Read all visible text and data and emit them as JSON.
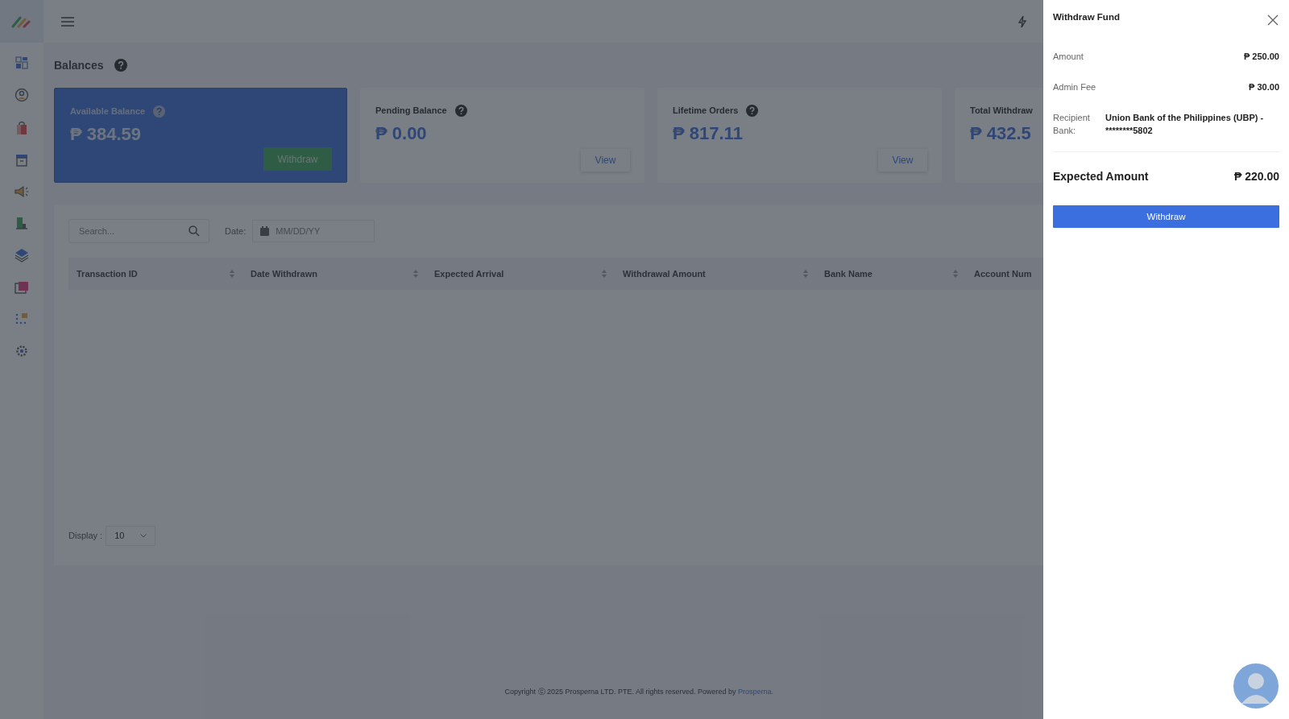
{
  "page_title": "Balances",
  "cards": [
    {
      "kind": "primary",
      "label": "Available Balance",
      "amount": "₱ 384.59",
      "button": "Withdraw"
    },
    {
      "kind": "plain",
      "label": "Pending Balance",
      "amount": "₱ 0.00",
      "button": "View"
    },
    {
      "kind": "plain",
      "label": "Lifetime Orders",
      "amount": "₱ 817.11",
      "button": "View"
    },
    {
      "kind": "plain",
      "label": "Total Withdraw",
      "amount": "₱ 432.5"
    }
  ],
  "filters": {
    "search": {
      "placeholder": "Search..."
    },
    "date_label": "Date:",
    "date": {
      "placeholder": "MM/DD/YY"
    }
  },
  "table": {
    "columns": [
      "Transaction ID",
      "Date Withdrawn",
      "Expected Arrival",
      "Withdrawal Amount",
      "Bank Name",
      "Account Num"
    ]
  },
  "pagination": {
    "label": "Display :",
    "value": "10"
  },
  "footer": {
    "text": "Copyright ⓒ 2025 Prosperna LTD. PTE. All rights reserved. Powered by",
    "link": "Prosperna."
  },
  "drawer": {
    "title": "Withdraw Fund",
    "rows": [
      {
        "label": "Amount",
        "value": "₱ 250.00"
      },
      {
        "label": "Admin Fee",
        "value": "₱ 30.00"
      },
      {
        "label": "Recipient Bank:",
        "value": "Union Bank of the Philippines (UBP) - ********5802"
      }
    ],
    "total": {
      "label": "Expected Amount",
      "value": "₱ 220.00"
    },
    "button": "Withdraw"
  }
}
